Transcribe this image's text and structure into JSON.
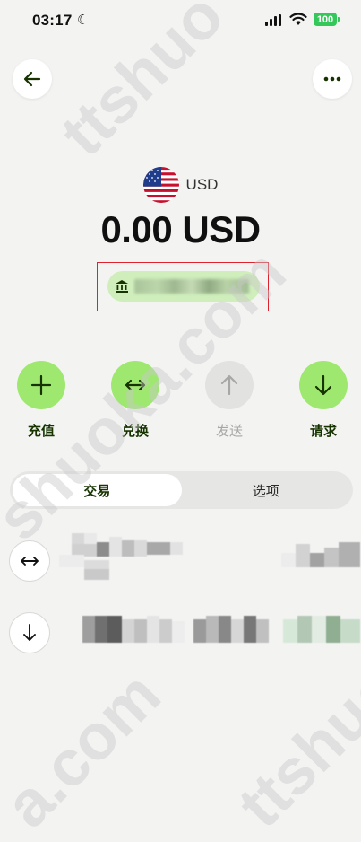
{
  "status_bar": {
    "time": "03:17",
    "battery": "100"
  },
  "header": {
    "back_icon": "arrow-left-icon",
    "more_icon": "more-horizontal-icon"
  },
  "account": {
    "currency_code": "USD",
    "flag_icon": "us-flag-icon",
    "balance": "0.00 USD",
    "bank_icon": "bank-icon"
  },
  "actions": [
    {
      "label": "充值",
      "icon": "plus-icon",
      "enabled": true
    },
    {
      "label": "兑换",
      "icon": "swap-horizontal-icon",
      "enabled": true
    },
    {
      "label": "发送",
      "icon": "arrow-up-icon",
      "enabled": false
    },
    {
      "label": "请求",
      "icon": "arrow-down-icon",
      "enabled": true
    }
  ],
  "tabs": [
    {
      "label": "交易",
      "active": true
    },
    {
      "label": "选项",
      "active": false
    }
  ],
  "transactions": [
    {
      "icon": "swap-horizontal-icon"
    },
    {
      "icon": "arrow-down-icon"
    }
  ],
  "watermark": [
    "ttshuo",
    "shuoka.com",
    "a.com",
    "ttshuo"
  ],
  "colors": {
    "accent": "#9fe870",
    "accent_dark": "#163300",
    "highlight_box": "#e0222e",
    "background": "#f3f4f2"
  }
}
